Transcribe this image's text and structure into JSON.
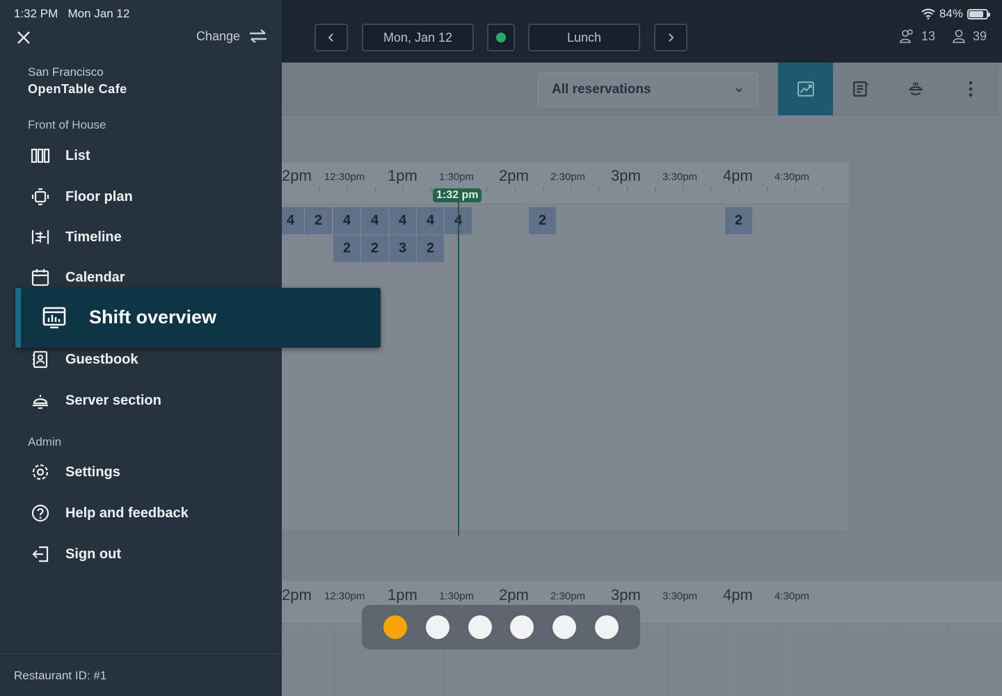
{
  "status": {
    "time": "1:32 PM",
    "date": "Mon Jan 12",
    "battery": "84%",
    "battery_level": 0.84
  },
  "topbar": {
    "date_label": "Mon, Jan 12",
    "shift_label": "Lunch",
    "party_count": "13",
    "cover_count": "39"
  },
  "drawer": {
    "change_label": "Change",
    "city": "San Francisco",
    "restaurant": "OpenTable Cafe",
    "section_front": "Front of House",
    "section_admin": "Admin",
    "items": {
      "list": "List",
      "floor_plan": "Floor plan",
      "timeline": "Timeline",
      "calendar": "Calendar",
      "shift_overview": "Shift overview",
      "guestbook": "Guestbook",
      "server_section": "Server section",
      "settings": "Settings",
      "help": "Help and feedback",
      "sign_out": "Sign out"
    },
    "restaurant_id": "Restaurant ID: #1"
  },
  "main": {
    "filter_label": "All reservations",
    "time_labels": [
      "2pm",
      "12:30pm",
      "1pm",
      "1:30pm",
      "2pm",
      "2:30pm",
      "3pm",
      "3:30pm",
      "4pm",
      "4:30pm"
    ],
    "now_label": "1:32 pm",
    "row1": [
      "4",
      "2",
      "4",
      "4",
      "4",
      "4",
      "4",
      "2",
      "2"
    ],
    "row2": [
      "2",
      "2",
      "3",
      "2"
    ]
  },
  "icons": {
    "active_tool": "chart-icon",
    "pager_active_color": "#f5a40a"
  }
}
